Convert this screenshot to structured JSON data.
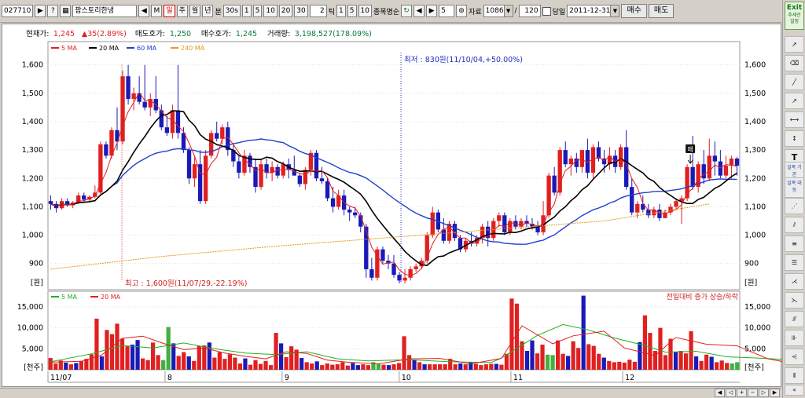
{
  "toolbar": {
    "code": "027710",
    "name": "팜스토리한냉",
    "tab_day": "일",
    "tab_week": "주",
    "tab_month": "월",
    "tab_year": "년",
    "minute_label": "분",
    "minute_value": "30s",
    "minute_buttons": [
      "1",
      "5",
      "10",
      "20",
      "30"
    ],
    "tick_value": "2",
    "tick_label": "틱",
    "tick_buttons": [
      "1",
      "5",
      "10"
    ],
    "compare_label": "종목명순",
    "page_value": "5",
    "data_label": "자료",
    "data_count": "1086",
    "slash": "/",
    "max_count": "120",
    "today_label": "당일",
    "date": "2011-12-31",
    "buy_button": "매수",
    "sell_button": "매도"
  },
  "price_info": {
    "current_label": "현재가:",
    "current": "1,245",
    "change": "▲35(2.89%)",
    "ask_label": "매도호가:",
    "ask": "1,250",
    "bid_label": "매수호가:",
    "bid": "1,245",
    "volume_label": "거래량:",
    "volume": "3,198,527(178.09%)"
  },
  "colors": {
    "up": "#e02020",
    "down": "#1a1ab8",
    "ma5": "#e02020",
    "ma20": "#000000",
    "ma60": "#2040d0",
    "ma240": "#e89a20",
    "vol_neutral": "#40b040",
    "vma20": "#20b020"
  },
  "chart_data": [
    {
      "type": "candlestick",
      "title": "",
      "unit_label": "[원]",
      "y_ticks": [
        "1,600",
        "1,500",
        "1,400",
        "1,300",
        "1,200",
        "1,100",
        "1,000",
        "900"
      ],
      "ylim": [
        830,
        1660
      ],
      "legend": [
        "5 MA",
        "20 MA",
        "60 MA",
        "240 MA"
      ],
      "annotation_low": "최저 : 830원(11/10/04,+50.00%)",
      "annotation_high": "최고 : 1,600원(11/07/29,-22.19%)",
      "marker_label": "매",
      "candles": [
        [
          1120,
          1140,
          1090,
          1110
        ],
        [
          1110,
          1120,
          1080,
          1095
        ],
        [
          1095,
          1130,
          1090,
          1120
        ],
        [
          1120,
          1130,
          1100,
          1105
        ],
        [
          1105,
          1120,
          1095,
          1115
        ],
        [
          1115,
          1150,
          1110,
          1140
        ],
        [
          1140,
          1150,
          1115,
          1125
        ],
        [
          1125,
          1140,
          1120,
          1135
        ],
        [
          1135,
          1175,
          1130,
          1150
        ],
        [
          1150,
          1330,
          1145,
          1320
        ],
        [
          1320,
          1330,
          1270,
          1280
        ],
        [
          1280,
          1380,
          1270,
          1370
        ],
        [
          1370,
          1450,
          1300,
          1330
        ],
        [
          1330,
          1580,
          1320,
          1560
        ],
        [
          1560,
          1600,
          1460,
          1480
        ],
        [
          1480,
          1520,
          1440,
          1500
        ],
        [
          1500,
          1560,
          1460,
          1470
        ],
        [
          1470,
          1600,
          1440,
          1450
        ],
        [
          1450,
          1500,
          1420,
          1480
        ],
        [
          1480,
          1560,
          1430,
          1440
        ],
        [
          1440,
          1460,
          1370,
          1380
        ],
        [
          1380,
          1420,
          1350,
          1360
        ],
        [
          1360,
          1460,
          1340,
          1440
        ],
        [
          1440,
          1600,
          1340,
          1360
        ],
        [
          1360,
          1380,
          1290,
          1300
        ],
        [
          1300,
          1310,
          1180,
          1200
        ],
        [
          1200,
          1280,
          1170,
          1250
        ],
        [
          1250,
          1300,
          1110,
          1120
        ],
        [
          1120,
          1300,
          1110,
          1280
        ],
        [
          1280,
          1370,
          1270,
          1360
        ],
        [
          1360,
          1400,
          1330,
          1340
        ],
        [
          1340,
          1390,
          1320,
          1380
        ],
        [
          1380,
          1400,
          1280,
          1300
        ],
        [
          1300,
          1320,
          1240,
          1260
        ],
        [
          1260,
          1280,
          1200,
          1220
        ],
        [
          1220,
          1300,
          1210,
          1280
        ],
        [
          1280,
          1290,
          1220,
          1240
        ],
        [
          1240,
          1270,
          1150,
          1170
        ],
        [
          1170,
          1270,
          1160,
          1250
        ],
        [
          1250,
          1270,
          1200,
          1220
        ],
        [
          1220,
          1260,
          1190,
          1240
        ],
        [
          1240,
          1250,
          1200,
          1210
        ],
        [
          1210,
          1260,
          1200,
          1250
        ],
        [
          1250,
          1270,
          1200,
          1230
        ],
        [
          1230,
          1280,
          1210,
          1210
        ],
        [
          1210,
          1220,
          1170,
          1180
        ],
        [
          1180,
          1240,
          1160,
          1230
        ],
        [
          1230,
          1300,
          1210,
          1290
        ],
        [
          1290,
          1300,
          1190,
          1200
        ],
        [
          1200,
          1240,
          1180,
          1190
        ],
        [
          1190,
          1200,
          1120,
          1130
        ],
        [
          1130,
          1170,
          1080,
          1100
        ],
        [
          1100,
          1160,
          1090,
          1140
        ],
        [
          1140,
          1160,
          1070,
          1090
        ],
        [
          1090,
          1100,
          1050,
          1080
        ],
        [
          1080,
          1100,
          1060,
          1070
        ],
        [
          1070,
          1080,
          1010,
          1030
        ],
        [
          1030,
          1040,
          850,
          880
        ],
        [
          880,
          920,
          840,
          850
        ],
        [
          850,
          960,
          840,
          950
        ],
        [
          950,
          960,
          900,
          910
        ],
        [
          910,
          930,
          880,
          900
        ],
        [
          900,
          930,
          850,
          860
        ],
        [
          860,
          870,
          830,
          840
        ],
        [
          840,
          880,
          830,
          850
        ],
        [
          850,
          890,
          840,
          880
        ],
        [
          880,
          900,
          870,
          890
        ],
        [
          890,
          920,
          880,
          910
        ],
        [
          910,
          1010,
          900,
          1000
        ],
        [
          1000,
          1100,
          990,
          1080
        ],
        [
          1080,
          1090,
          1010,
          1020
        ],
        [
          1020,
          1060,
          970,
          980
        ],
        [
          980,
          1050,
          970,
          1040
        ],
        [
          1040,
          1050,
          980,
          990
        ],
        [
          990,
          1000,
          940,
          950
        ],
        [
          950,
          990,
          940,
          980
        ],
        [
          980,
          1010,
          960,
          970
        ],
        [
          970,
          1000,
          960,
          990
        ],
        [
          990,
          1040,
          970,
          1030
        ],
        [
          1030,
          1050,
          960,
          990
        ],
        [
          990,
          1060,
          980,
          1050
        ],
        [
          1050,
          1080,
          1030,
          1070
        ],
        [
          1070,
          1080,
          1000,
          1010
        ],
        [
          1010,
          1060,
          1000,
          1050
        ],
        [
          1050,
          1070,
          1020,
          1030
        ],
        [
          1030,
          1060,
          1020,
          1050
        ],
        [
          1050,
          1070,
          1030,
          1040
        ],
        [
          1040,
          1060,
          1020,
          1030
        ],
        [
          1030,
          1050,
          1000,
          1010
        ],
        [
          1010,
          1120,
          1000,
          1070
        ],
        [
          1070,
          1220,
          1060,
          1210
        ],
        [
          1210,
          1240,
          1140,
          1150
        ],
        [
          1150,
          1310,
          1140,
          1300
        ],
        [
          1300,
          1330,
          1240,
          1250
        ],
        [
          1250,
          1280,
          1210,
          1270
        ],
        [
          1270,
          1290,
          1220,
          1240
        ],
        [
          1240,
          1300,
          1220,
          1300
        ],
        [
          1300,
          1340,
          1200,
          1220
        ],
        [
          1220,
          1320,
          1200,
          1310
        ],
        [
          1310,
          1330,
          1260,
          1270
        ],
        [
          1270,
          1300,
          1220,
          1250
        ],
        [
          1250,
          1310,
          1230,
          1280
        ],
        [
          1280,
          1300,
          1220,
          1240
        ],
        [
          1240,
          1320,
          1230,
          1310
        ],
        [
          1310,
          1370,
          1160,
          1170
        ],
        [
          1170,
          1200,
          1070,
          1080
        ],
        [
          1080,
          1120,
          1060,
          1110
        ],
        [
          1110,
          1140,
          1080,
          1090
        ],
        [
          1090,
          1110,
          1060,
          1070
        ],
        [
          1070,
          1100,
          1060,
          1090
        ],
        [
          1090,
          1110,
          1050,
          1060
        ],
        [
          1060,
          1090,
          1060,
          1080
        ],
        [
          1080,
          1110,
          1070,
          1100
        ],
        [
          1100,
          1130,
          1090,
          1120
        ],
        [
          1120,
          1140,
          1040,
          1130
        ],
        [
          1130,
          1250,
          1120,
          1240
        ],
        [
          1240,
          1350,
          1160,
          1170
        ],
        [
          1170,
          1260,
          1150,
          1250
        ],
        [
          1250,
          1300,
          1180,
          1200
        ],
        [
          1200,
          1340,
          1190,
          1280
        ],
        [
          1280,
          1330,
          1210,
          1260
        ],
        [
          1260,
          1300,
          1200,
          1210
        ],
        [
          1210,
          1280,
          1200,
          1245
        ],
        [
          1245,
          1280,
          1200,
          1270
        ],
        [
          1270,
          1275,
          1210,
          1245
        ]
      ],
      "ma240": [
        [
          0,
          880
        ],
        [
          20,
          925
        ],
        [
          40,
          960
        ],
        [
          60,
          990
        ],
        [
          80,
          1020
        ],
        [
          100,
          1050
        ],
        [
          119,
          1110
        ]
      ]
    },
    {
      "type": "bar",
      "title": "",
      "unit_label": "[천주]",
      "legend": [
        "5 MA",
        "20 MA"
      ],
      "right_title": "전일대비 증가 상승/하락",
      "y_ticks": [
        "15,000",
        "10,000",
        "5,000"
      ],
      "ylim": [
        0,
        18000
      ],
      "values": [
        2800,
        1500,
        2200,
        1700,
        1300,
        1600,
        2100,
        2600,
        3700,
        12200,
        3200,
        9500,
        8500,
        11000,
        7400,
        5600,
        6000,
        7100,
        2700,
        2300,
        6500,
        3500,
        2300,
        10200,
        6300,
        3300,
        4200,
        3200,
        2100,
        5700,
        5800,
        6500,
        2900,
        4200,
        2600,
        3700,
        2900,
        1500,
        2700,
        1200,
        2300,
        1400,
        2100,
        1100,
        8800,
        6300,
        3000,
        5600,
        4800,
        2800,
        1800,
        1500,
        2000,
        1100,
        1500,
        1200,
        1300,
        1800,
        1000,
        1600,
        1100,
        1300,
        1100,
        1800,
        1500,
        1200,
        1100,
        1300,
        1600,
        8000,
        3500,
        2300,
        1800,
        1300,
        1300,
        1300,
        1300,
        1300,
        2600,
        1300,
        1500,
        1300,
        1800,
        1400,
        1100,
        1300,
        1400,
        1400,
        1200,
        3800,
        17000,
        15800,
        6800,
        4500,
        7000,
        3900,
        6000,
        3600,
        3500,
        7000,
        3800,
        3300,
        6800,
        5200,
        17700,
        6100,
        5700,
        3800,
        2900,
        2100,
        1800,
        1900,
        1700,
        2400,
        1900,
        6600,
        13000,
        8800,
        4500,
        10000,
        3500,
        7400,
        4300,
        4500,
        3900,
        9200,
        3200,
        2100,
        3600,
        3100,
        1800,
        2200,
        1600,
        1500,
        1800
      ],
      "vma20": [
        [
          0,
          1900
        ],
        [
          8,
          3800
        ],
        [
          14,
          5800
        ],
        [
          20,
          5200
        ],
        [
          26,
          6400
        ],
        [
          32,
          5000
        ],
        [
          38,
          4000
        ],
        [
          44,
          3600
        ],
        [
          50,
          4300
        ],
        [
          56,
          2600
        ],
        [
          62,
          2100
        ],
        [
          70,
          2400
        ],
        [
          78,
          1900
        ],
        [
          86,
          1700
        ],
        [
          88,
          2800
        ],
        [
          95,
          8200
        ],
        [
          100,
          10800
        ],
        [
          105,
          9500
        ],
        [
          110,
          7600
        ],
        [
          116,
          5800
        ],
        [
          120,
          4200
        ],
        [
          126,
          4400
        ],
        [
          132,
          3100
        ],
        [
          138,
          2800
        ],
        [
          144,
          2400
        ]
      ],
      "vma5": [
        [
          0,
          1800
        ],
        [
          6,
          2000
        ],
        [
          10,
          3500
        ],
        [
          14,
          7500
        ],
        [
          18,
          8000
        ],
        [
          22,
          6300
        ],
        [
          26,
          4800
        ],
        [
          30,
          5200
        ],
        [
          34,
          4000
        ],
        [
          38,
          3200
        ],
        [
          42,
          2600
        ],
        [
          46,
          4300
        ],
        [
          50,
          3900
        ],
        [
          54,
          2300
        ],
        [
          58,
          1800
        ],
        [
          64,
          1400
        ],
        [
          70,
          2600
        ],
        [
          76,
          2700
        ],
        [
          82,
          1400
        ],
        [
          88,
          2700
        ],
        [
          92,
          10500
        ],
        [
          98,
          6200
        ],
        [
          102,
          8100
        ],
        [
          108,
          9200
        ],
        [
          112,
          5200
        ],
        [
          118,
          3400
        ],
        [
          122,
          7700
        ],
        [
          128,
          6100
        ],
        [
          134,
          5700
        ],
        [
          140,
          2600
        ],
        [
          144,
          1700
        ]
      ]
    }
  ],
  "x_axis": {
    "labels": [
      "11/07",
      "8",
      "9",
      "10",
      "11",
      "12"
    ],
    "positions": [
      0,
      22,
      44,
      66,
      87,
      108
    ]
  },
  "tools": {
    "exit": "Exit",
    "exit_sub": "추세선 설정",
    "group1": "일목 기본",
    "group2": "일목 대등"
  }
}
